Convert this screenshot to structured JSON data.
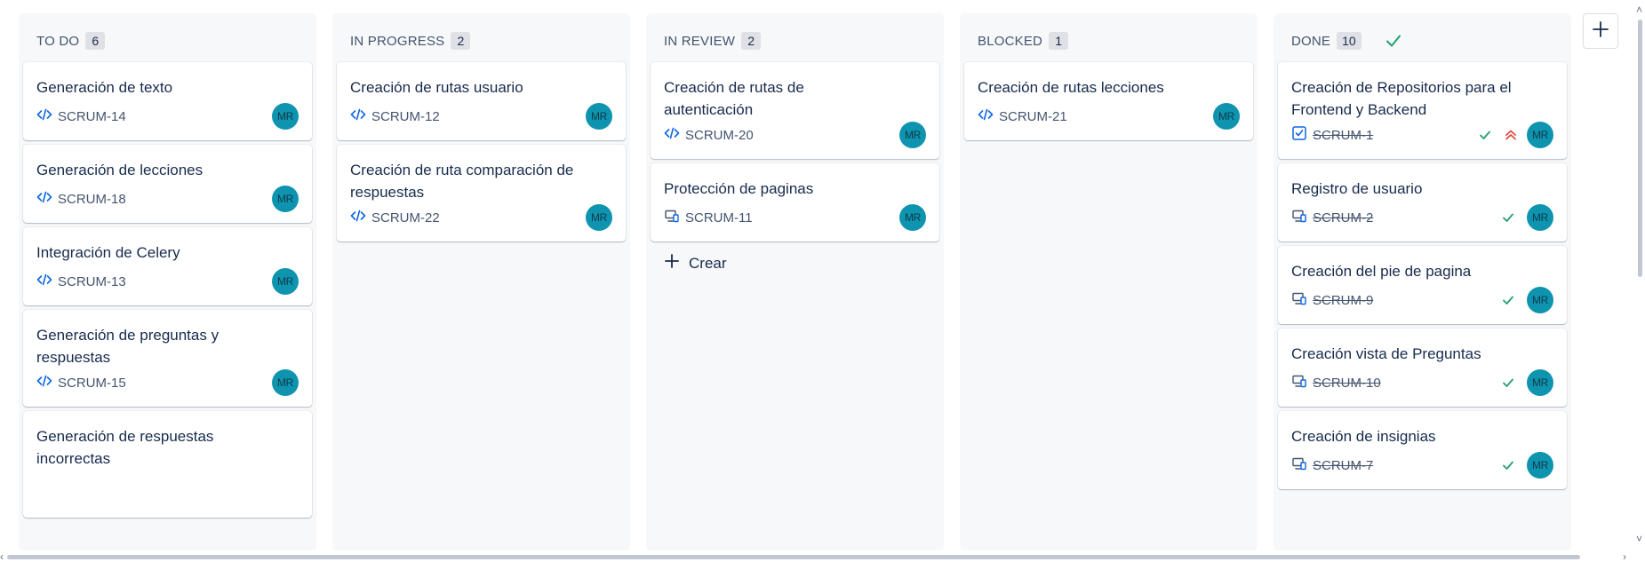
{
  "columns": [
    {
      "title": "TO DO",
      "count": "6"
    },
    {
      "title": "IN PROGRESS",
      "count": "2"
    },
    {
      "title": "IN REVIEW",
      "count": "2"
    },
    {
      "title": "BLOCKED",
      "count": "1"
    },
    {
      "title": "DONE",
      "count": "10"
    }
  ],
  "todo": [
    {
      "title": "Generación de texto",
      "key": "SCRUM-14",
      "avatar": "MR",
      "type": "code-icon"
    },
    {
      "title": "Generación de lecciones",
      "key": "SCRUM-18",
      "avatar": "MR",
      "type": "code-icon"
    },
    {
      "title": "Integración de Celery",
      "key": "SCRUM-13",
      "avatar": "MR",
      "type": "code-icon"
    },
    {
      "title": "Generación de preguntas y respuestas",
      "key": "SCRUM-15",
      "avatar": "MR",
      "type": "code-icon"
    },
    {
      "title": "Generación de respuestas incorrectas"
    }
  ],
  "in_progress": [
    {
      "title": "Creación de rutas usuario",
      "key": "SCRUM-12",
      "avatar": "MR",
      "type": "code-icon"
    },
    {
      "title": "Creación de ruta comparación de respuestas",
      "key": "SCRUM-22",
      "avatar": "MR",
      "type": "code-icon"
    }
  ],
  "in_review": [
    {
      "title": "Creación de rutas de autenticación",
      "key": "SCRUM-20",
      "avatar": "MR",
      "type": "code-icon"
    },
    {
      "title": "Protección de paginas",
      "key": "SCRUM-11",
      "avatar": "MR",
      "type": "frontend-icon"
    }
  ],
  "in_review_create": "Crear",
  "blocked": [
    {
      "title": "Creación de rutas lecciones",
      "key": "SCRUM-21",
      "avatar": "MR",
      "type": "code-icon"
    }
  ],
  "done": [
    {
      "title": "Creación de Repositorios para el Frontend y Backend",
      "key": "SCRUM-1",
      "avatar": "MR",
      "type": "task-checkbox-icon",
      "priority": "highest-priority-icon"
    },
    {
      "title": "Registro de usuario",
      "key": "SCRUM-2",
      "avatar": "MR",
      "type": "frontend-icon"
    },
    {
      "title": "Creación del pie de pagina",
      "key": "SCRUM-9",
      "avatar": "MR",
      "type": "frontend-icon"
    },
    {
      "title": "Creación vista de Preguntas",
      "key": "SCRUM-10",
      "avatar": "MR",
      "type": "frontend-icon"
    },
    {
      "title": "Creación de insignias",
      "key": "SCRUM-7",
      "avatar": "MR",
      "type": "frontend-icon"
    }
  ],
  "colors": {
    "accent": "#0c66e4",
    "done_check": "#22a06b",
    "avatar_bg": "#0f94b0",
    "priority": "#e2483d"
  }
}
